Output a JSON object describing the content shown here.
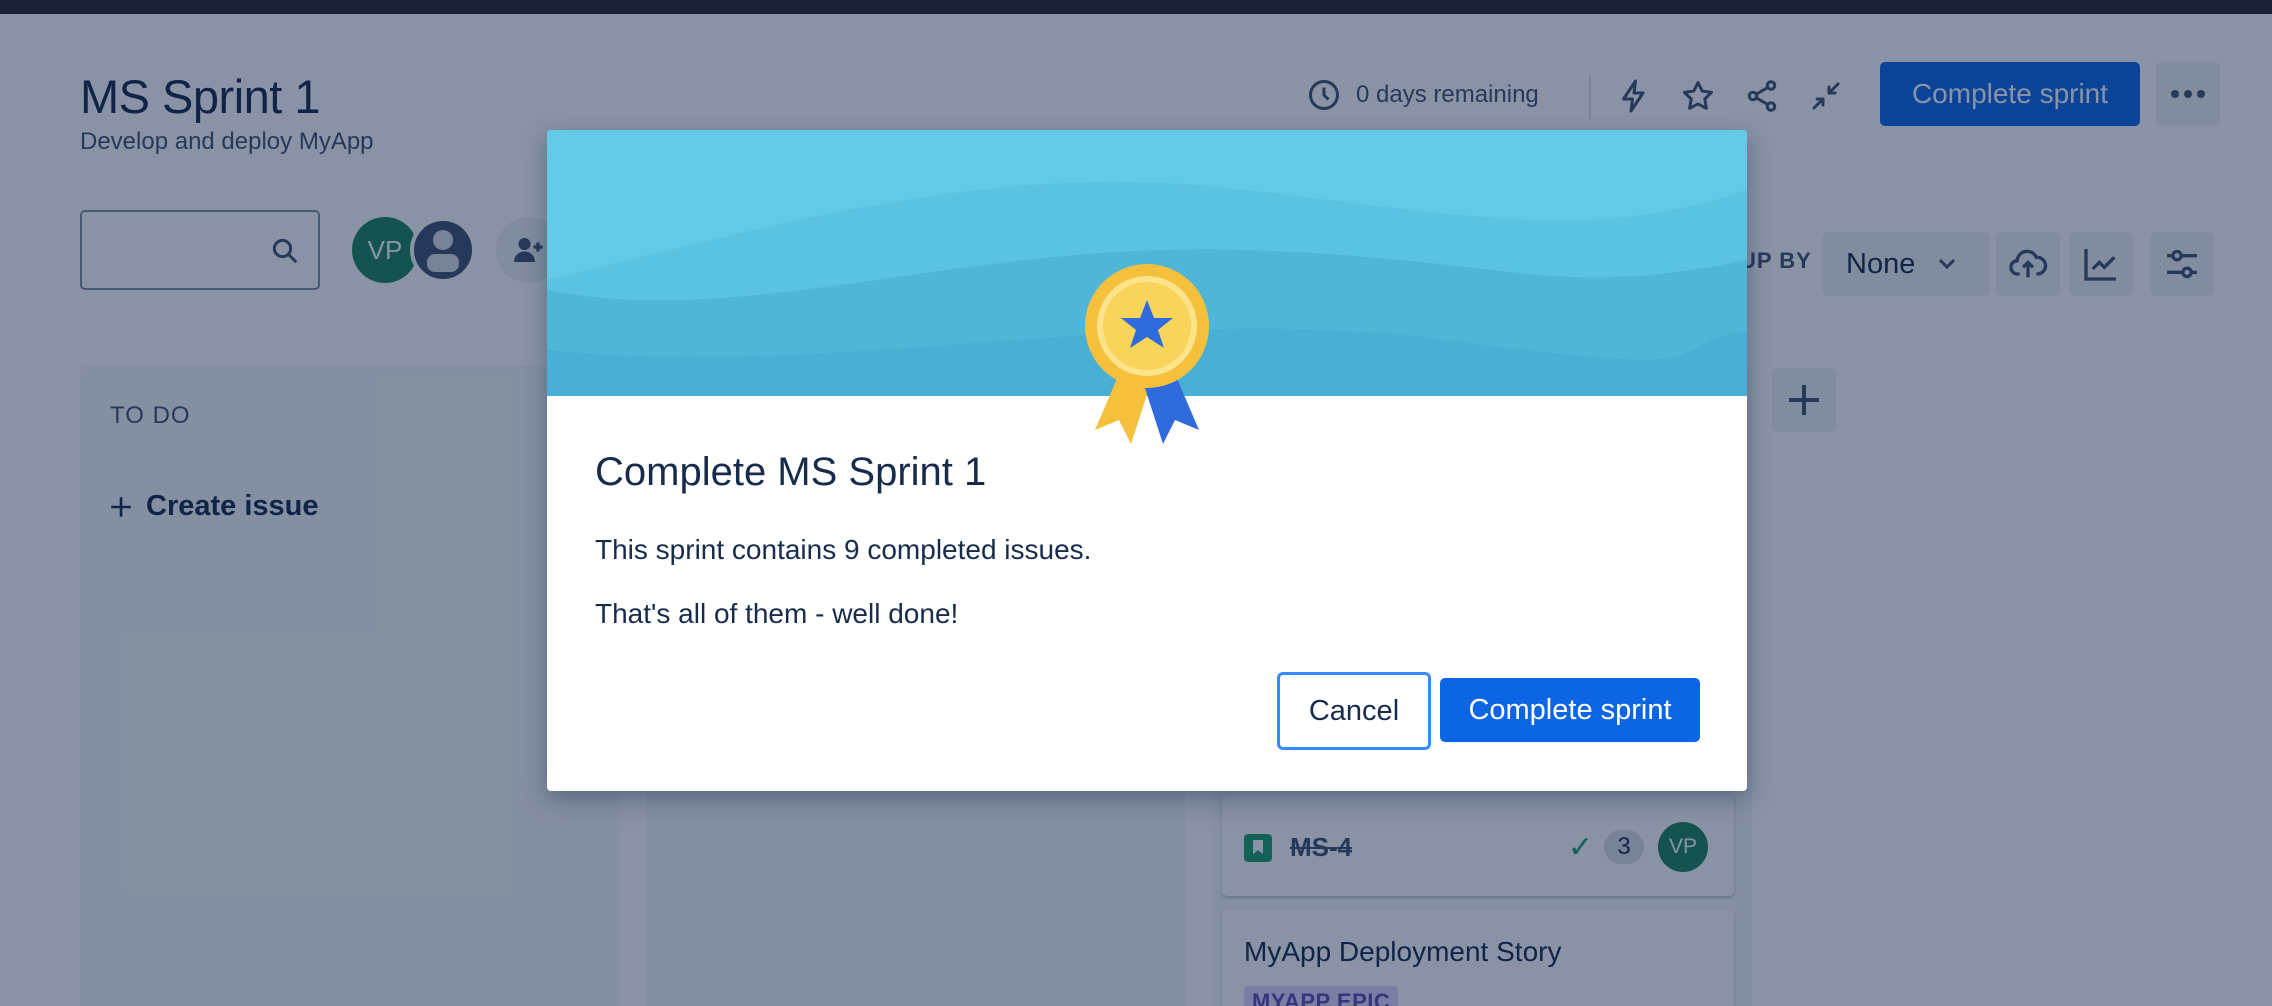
{
  "header": {
    "title": "MS Sprint 1",
    "subtitle": "Develop and deploy MyApp",
    "timer_text": "0 days remaining",
    "complete_button": "Complete sprint"
  },
  "toolbar": {
    "avatar_initials": "VP",
    "group_by_label": "UP BY",
    "group_by_value": "None"
  },
  "board": {
    "columns": [
      {
        "title": "TO DO",
        "create_label": "Create issue"
      }
    ],
    "cards": [
      {
        "key": "MS-4",
        "points": "3",
        "assignee": "VP"
      },
      {
        "title": "MyApp Deployment Story",
        "epic": "MYAPP EPIC"
      }
    ]
  },
  "modal": {
    "title": "Complete MS Sprint 1",
    "text1": "This sprint contains 9 completed issues.",
    "text2": "That's all of them - well done!",
    "cancel_label": "Cancel",
    "confirm_label": "Complete sprint"
  },
  "colors": {
    "primary": "#0c66e4",
    "banner": "#5bc3e2",
    "success": "#22a06b",
    "overlay": "rgba(9,30,66,0.48)"
  }
}
